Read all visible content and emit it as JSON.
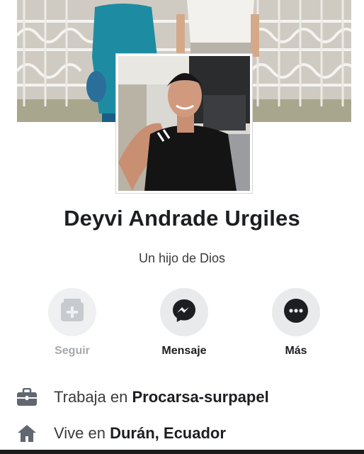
{
  "profile": {
    "name": "Deyvi Andrade Urgiles",
    "bio": "Un hijo de Dios"
  },
  "actions": [
    {
      "label": "Seguir",
      "icon": "add-friend-icon",
      "enabled": false
    },
    {
      "label": "Mensaje",
      "icon": "messenger-icon",
      "enabled": true
    },
    {
      "label": "Más",
      "icon": "more-icon",
      "enabled": true
    }
  ],
  "info": {
    "work_prefix": "Trabaja en",
    "work_place": "Procarsa-surpapel",
    "home_prefix": "Vive en",
    "home_place": "Durán, Ecuador"
  },
  "colors": {
    "button_bg": "#e9eaec",
    "text_primary": "#1c1e21",
    "text_secondary": "#3a3b3c",
    "disabled_text": "#a6a9ad"
  }
}
